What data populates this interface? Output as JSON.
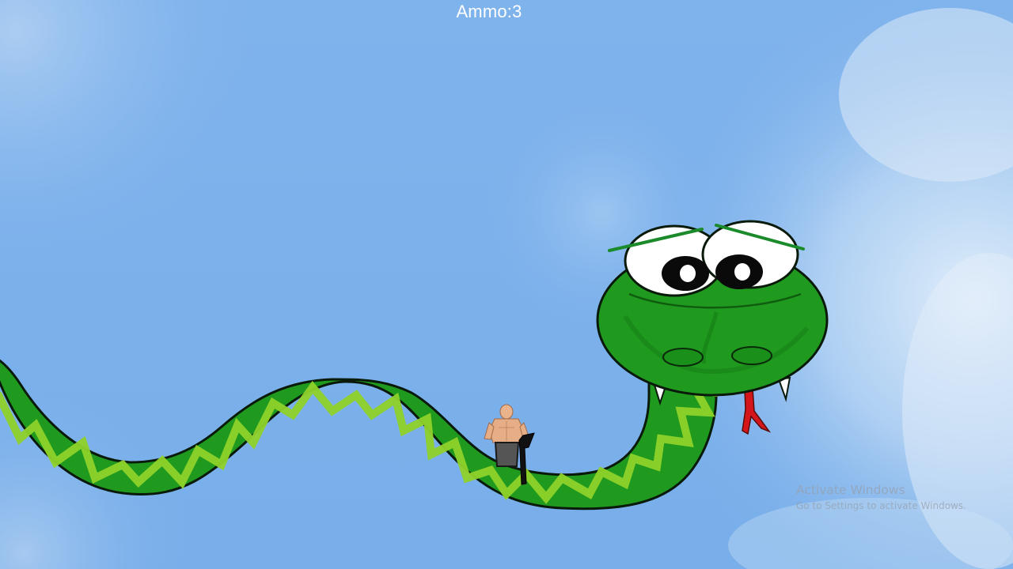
{
  "hud": {
    "ammo_label": "Ammo:",
    "ammo_count": "3"
  },
  "watermark": {
    "title": "Activate Windows",
    "subtitle": "Go to Settings to activate Windows."
  },
  "sprites": {
    "boss": "giant-green-snake",
    "player": "shirtless-gunman-player",
    "weapon": "rifle-icon"
  },
  "colors": {
    "sky": "#7db1ec",
    "snake_body": "#1f9a1f",
    "snake_pattern": "#8fd22a",
    "snake_outline": "#0a1a0a",
    "tongue": "#d4161b",
    "hud_text": "#ffffff"
  }
}
